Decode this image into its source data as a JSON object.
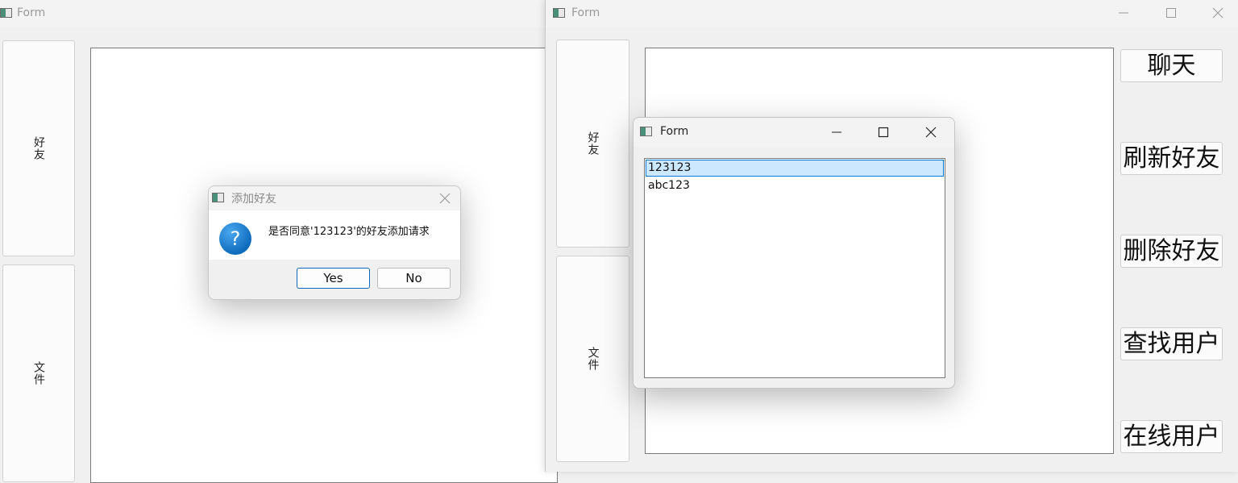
{
  "left_window": {
    "title": "Form",
    "side_buttons": {
      "friends": "好友",
      "files": "文件"
    }
  },
  "right_window": {
    "title": "Form",
    "side_buttons": {
      "friends": "好友",
      "files": "文件"
    },
    "action_buttons": {
      "chat": "聊天",
      "refresh_friends": "刷新好友",
      "delete_friend": "删除好友",
      "search_user": "查找用户",
      "online_users": "在线用户"
    }
  },
  "list_dialog": {
    "title": "Form",
    "items": [
      "123123",
      "abc123"
    ],
    "selected_index": 0
  },
  "message_box": {
    "title": "添加好友",
    "message": "是否同意'123123'的好友添加请求",
    "icon": "question-icon",
    "yes_label": "Yes",
    "no_label": "No"
  },
  "colors": {
    "accent": "#0f6cbd",
    "selection": "#cce8ff",
    "selection_border": "#0078d4"
  }
}
